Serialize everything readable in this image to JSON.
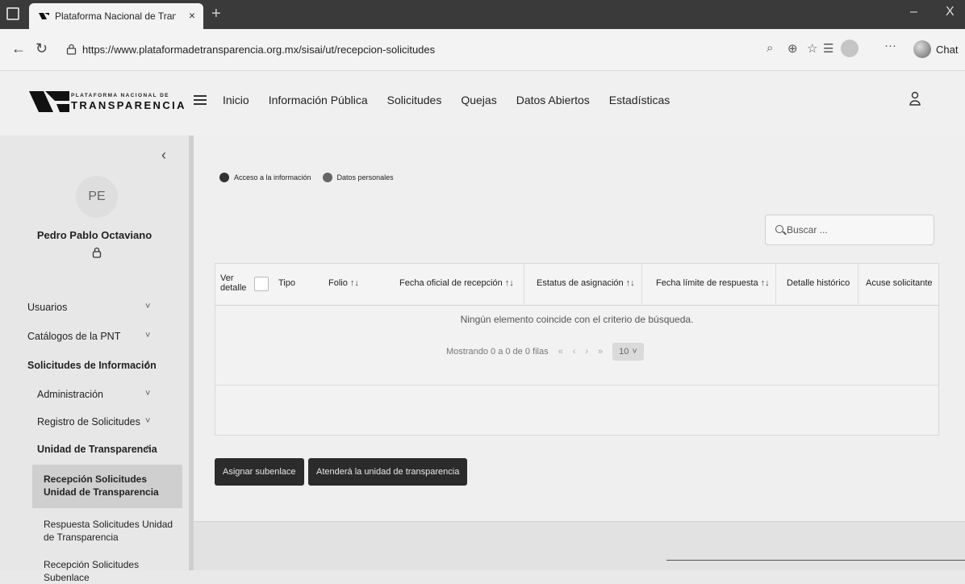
{
  "browser": {
    "tab_title": "Plataforma Nacional de Transpar",
    "tab_close": "×",
    "new_tab": "+",
    "url": "https://www.plataformadetransparencia.org.mx/sisai/ut/recepcion-solicitudes",
    "chat_label": "Chat",
    "more": "···",
    "minimize": "–",
    "close": "X"
  },
  "header": {
    "logo_small": "PLATAFORMA NACIONAL DE",
    "logo_big": "TRANSPARENCIA",
    "nav": [
      "Inicio",
      "Información Pública",
      "Solicitudes",
      "Quejas",
      "Datos Abiertos",
      "Estadísticas"
    ]
  },
  "sidebar": {
    "collapse": "‹",
    "initials": "PE",
    "user_name": "Pedro Pablo Octaviano",
    "items": {
      "usuarios": "Usuarios",
      "catalogos": "Catálogos de la PNT",
      "solicitudes": "Solicitudes de Información",
      "administracion": "Administración",
      "registro": "Registro de Solicitudes",
      "unidad": "Unidad de Transparencia",
      "recepcion_ut": "Recepción Solicitudes Unidad de Transparencia",
      "respuesta_ut": "Respuesta Solicitudes Unidad de Transparencia",
      "recepcion_sub": "Recepción Solicitudes Subenlace"
    }
  },
  "content": {
    "legend": [
      "Acceso a la información",
      "Datos personales"
    ],
    "search_placeholder": "Buscar ...",
    "columns": {
      "ver": "Ver",
      "detalle": "detalle",
      "tipo": "Tipo",
      "folio": "Folio",
      "fecha_recepcion": "Fecha oficial de recepción",
      "estatus": "Estatus de asignación",
      "fecha_limite": "Fecha límite de respuesta",
      "historico": "Detalle histórico",
      "acuse": "Acuse solicitante"
    },
    "sort_glyph": "↑↓",
    "empty_message": "Ningún elemento coincide con el criterio de búsqueda.",
    "pager_text": "Mostrando 0 a 0 de 0 filas",
    "pager_first": "«",
    "pager_prev": "‹",
    "pager_next": "›",
    "pager_last": "»",
    "page_size": "10",
    "buttons": {
      "asignar": "Asignar subenlace",
      "atendera": "Atenderá la unidad de transparencia"
    }
  }
}
